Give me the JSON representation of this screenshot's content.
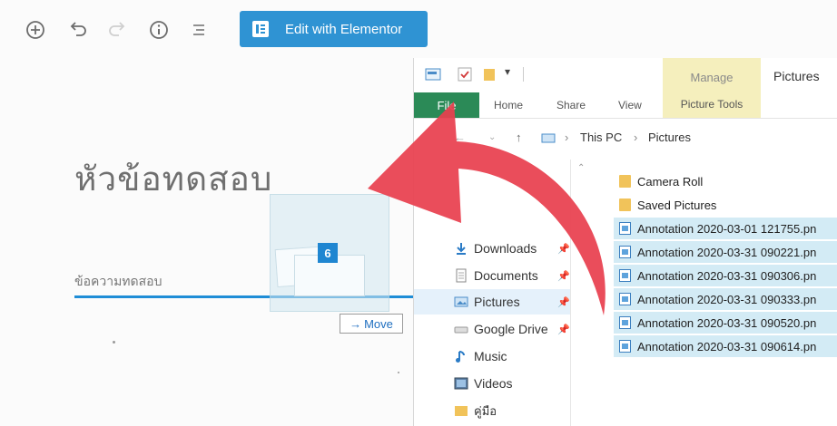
{
  "editor": {
    "toolbar": {
      "add_icon": "plus-circle-icon",
      "undo_icon": "undo-icon",
      "redo_icon": "redo-icon",
      "info_icon": "info-icon",
      "outline_icon": "list-view-icon",
      "elementor_button_label": "Edit with Elementor"
    },
    "page_title": "หัวข้อทดสอบ",
    "paragraph_placeholder": "ข้อความทดสอบ"
  },
  "drag": {
    "count": "6",
    "tooltip_label": "Move",
    "tooltip_arrow": "→"
  },
  "explorer": {
    "window_title": "Pictures",
    "contextual_group": "Manage",
    "contextual_tab": "Picture Tools",
    "ribbon_tabs": [
      "File",
      "Home",
      "Share",
      "View"
    ],
    "breadcrumb": [
      "This PC",
      "Pictures"
    ],
    "nav_items": [
      {
        "label": "Downloads",
        "icon": "downloads-icon",
        "pinned": true
      },
      {
        "label": "Documents",
        "icon": "documents-icon",
        "pinned": true
      },
      {
        "label": "Pictures",
        "icon": "pictures-icon",
        "pinned": true,
        "selected": true
      },
      {
        "label": "Google Drive",
        "icon": "google-drive-icon",
        "pinned": true
      },
      {
        "label": "Music",
        "icon": "music-icon",
        "pinned": false
      },
      {
        "label": "Videos",
        "icon": "videos-icon",
        "pinned": false
      },
      {
        "label": "คู่มือ",
        "icon": "folder-icon",
        "pinned": false
      }
    ],
    "files": [
      {
        "name": "Camera Roll",
        "type": "folder",
        "selected": false
      },
      {
        "name": "Saved Pictures",
        "type": "folder",
        "selected": false
      },
      {
        "name": "Annotation 2020-03-01 121755.pn",
        "type": "image",
        "selected": true
      },
      {
        "name": "Annotation 2020-03-31 090221.pn",
        "type": "image",
        "selected": true
      },
      {
        "name": "Annotation 2020-03-31 090306.pn",
        "type": "image",
        "selected": true
      },
      {
        "name": "Annotation 2020-03-31 090333.pn",
        "type": "image",
        "selected": true
      },
      {
        "name": "Annotation 2020-03-31 090520.pn",
        "type": "image",
        "selected": true
      },
      {
        "name": "Annotation 2020-03-31 090614.pn",
        "type": "image",
        "selected": true
      }
    ]
  },
  "colors": {
    "elementor_blue": "#2f93d3",
    "file_tab_green": "#2b8a57",
    "manage_tab_yellow": "#f5efbd",
    "selection_blue": "#d3ebf5",
    "arrow_red": "#e8404f"
  }
}
